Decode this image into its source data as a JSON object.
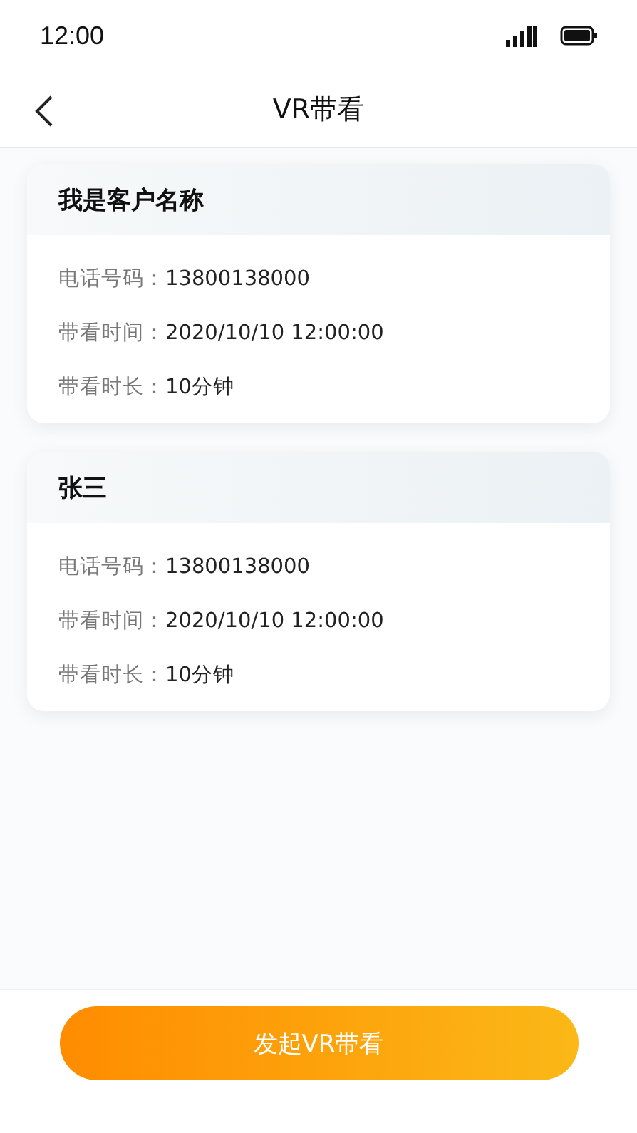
{
  "status_bar": {
    "time": "12:00"
  },
  "nav": {
    "title": "VR带看"
  },
  "cards": [
    {
      "name": "我是客户名称",
      "fields": [
        {
          "label": "电话号码：",
          "value": "13800138000"
        },
        {
          "label": "带看时间：",
          "value": "2020/10/10 12:00:00"
        },
        {
          "label": "带看时长：",
          "value": "10分钟"
        }
      ]
    },
    {
      "name": "张三",
      "fields": [
        {
          "label": "电话号码：",
          "value": "13800138000"
        },
        {
          "label": "带看时间：",
          "value": "2020/10/10 12:00:00"
        },
        {
          "label": "带看时长：",
          "value": "10分钟"
        }
      ]
    }
  ],
  "action_button": "发起VR带看"
}
